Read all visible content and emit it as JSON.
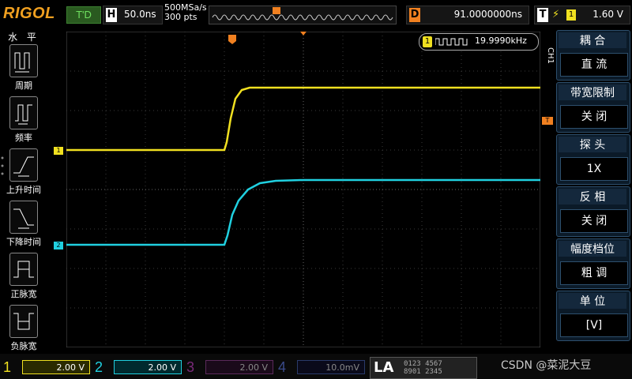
{
  "topbar": {
    "logo": "RIGOL",
    "run_mode": "T'D",
    "timebase_label": "H",
    "timebase_value": "50.0ns",
    "sample_rate": "500MSa/s",
    "memory_depth": "300 pts",
    "delay_label": "D",
    "delay_value": "91.0000000ns",
    "trigger_label": "T",
    "trigger_source": "1",
    "trigger_level": "1.60 V"
  },
  "left_menu": {
    "title": "水 平",
    "items": [
      {
        "label": "周期"
      },
      {
        "label": "频率"
      },
      {
        "label": "上升时间"
      },
      {
        "label": "下降时间"
      },
      {
        "label": "正脉宽"
      },
      {
        "label": "负脉宽"
      }
    ]
  },
  "frequency_readout": {
    "channel": "1",
    "value": "19.9990kHz"
  },
  "right_menu": {
    "channel_tab": "CH1",
    "items": [
      {
        "title": "耦 合",
        "value": "直 流"
      },
      {
        "title": "带宽限制",
        "value": "关 闭"
      },
      {
        "title": "探 头",
        "value": "1X"
      },
      {
        "title": "反 相",
        "value": "关 闭"
      },
      {
        "title": "幅度档位",
        "value": "粗 调"
      },
      {
        "title": "单 位",
        "value": "[V]"
      }
    ]
  },
  "channels": [
    {
      "num": "1",
      "scale": "2.00 V",
      "color": "#f0e020"
    },
    {
      "num": "2",
      "scale": "2.00 V",
      "color": "#20d0e0"
    },
    {
      "num": "3",
      "scale": "2.00 V",
      "color": "#c040c0"
    },
    {
      "num": "4",
      "scale": "10.0mV",
      "color": "#3060e0"
    }
  ],
  "la": {
    "label": "LA",
    "row1": "0123 4567",
    "row2": "8901 2345"
  },
  "markers": {
    "ch1": "1",
    "ch2": "2",
    "trig": "T"
  },
  "watermark": "CSDN @菜泥大豆",
  "colors": {
    "ch1": "#f0e020",
    "ch2": "#20d0e0",
    "trigger": "#f08020",
    "accent": "#4aa8ff"
  }
}
